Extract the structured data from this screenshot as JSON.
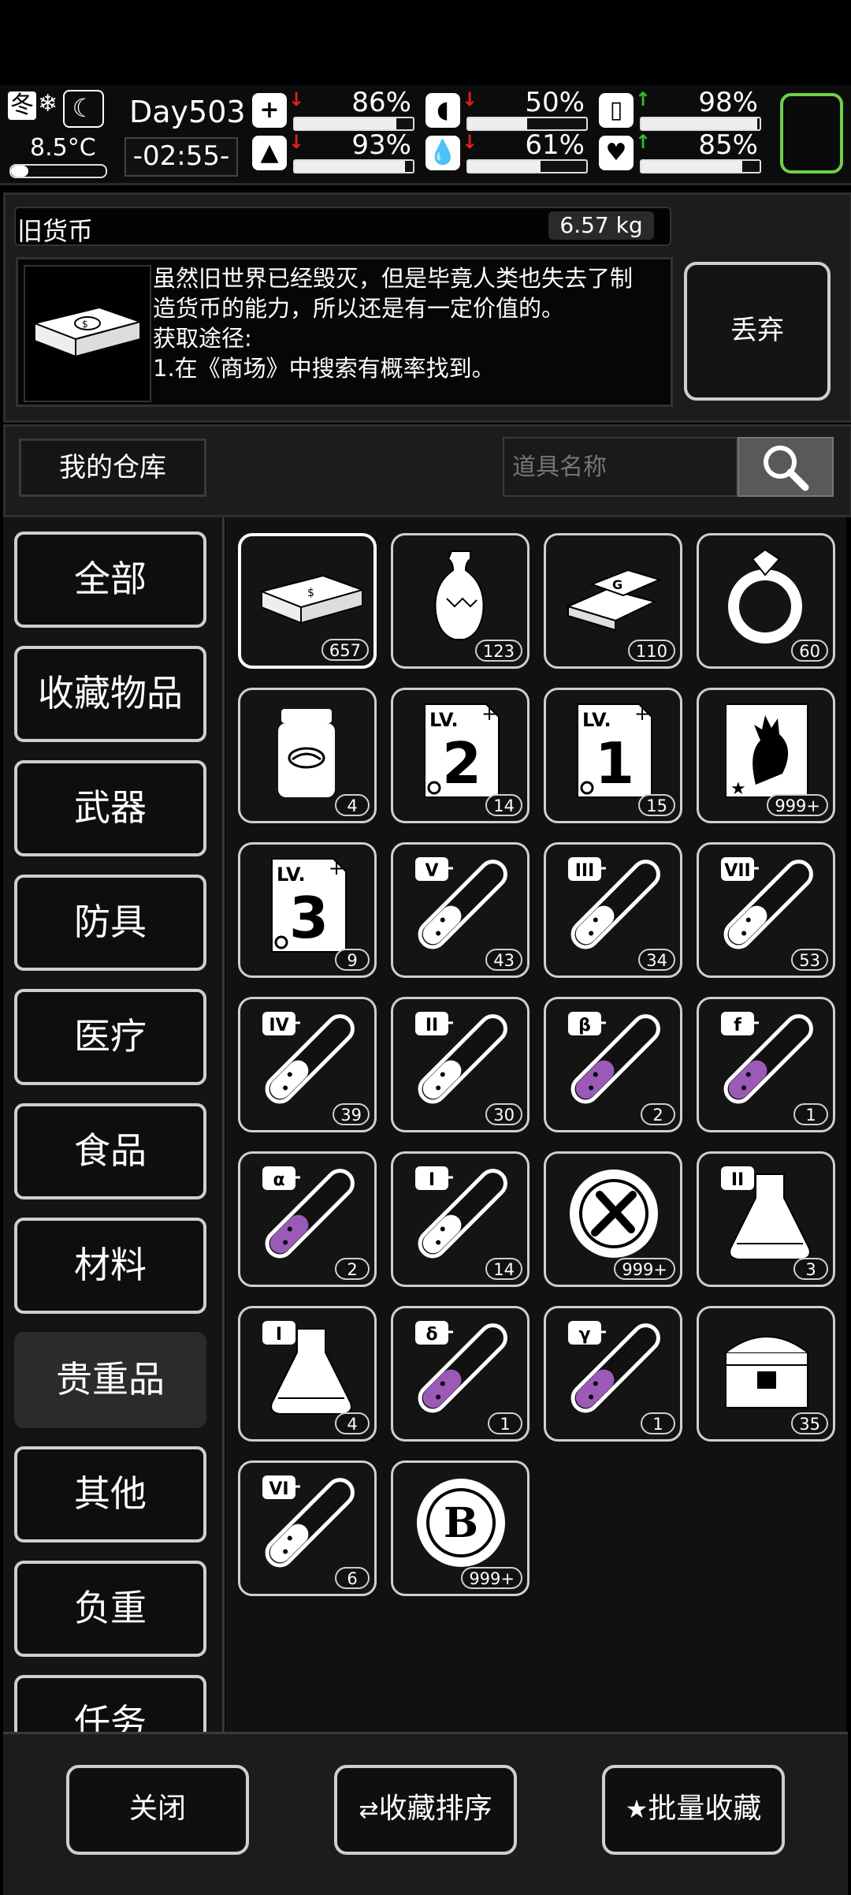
{
  "status": {
    "season": "冬",
    "temperature": "8.5°C",
    "day": "Day503",
    "time": "-02:55-",
    "stats": [
      {
        "name": "health",
        "icon": "+",
        "arrow": "down",
        "value": "86%",
        "level": 0.86
      },
      {
        "name": "stomach",
        "icon": "◖",
        "arrow": "down",
        "value": "50%",
        "level": 0.5
      },
      {
        "name": "pill",
        "icon": "▯",
        "arrow": "up",
        "value": "98%",
        "level": 0.98
      },
      {
        "name": "stamina",
        "icon": "▲",
        "arrow": "down",
        "value": "93%",
        "level": 0.93
      },
      {
        "name": "water",
        "icon": "💧",
        "arrow": "down",
        "value": "61%",
        "level": 0.61
      },
      {
        "name": "mood",
        "icon": "♥",
        "arrow": "up",
        "value": "85%",
        "level": 0.85
      }
    ],
    "accent_green": "#6fd04a",
    "arrow_down_color": "#e02020",
    "arrow_up_color": "#2cc02c"
  },
  "detail": {
    "item_name": "旧货币",
    "weight": "6.57 kg",
    "description": [
      "虽然旧世界已经毁灭，但是毕竟人类也失去了制",
      "造货币的能力，所以还是有一定价值的。",
      "获取途径:",
      "1.在《商场》中搜索有概率找到。"
    ],
    "discard_label": "丢弃"
  },
  "warehouse": {
    "title": "我的仓库",
    "search_placeholder": "道具名称"
  },
  "categories": [
    "全部",
    "收藏物品",
    "武器",
    "防具",
    "医疗",
    "食品",
    "材料",
    "贵重品",
    "其他",
    "负重",
    "任务"
  ],
  "active_category": "贵重品",
  "items": [
    {
      "icon": "money-stack-icon",
      "count": "657",
      "selected": true
    },
    {
      "icon": "vase-icon",
      "count": "123"
    },
    {
      "icon": "gold-bars-icon",
      "count": "110"
    },
    {
      "icon": "ring-icon",
      "count": "60"
    },
    {
      "icon": "jar-icon",
      "count": "4"
    },
    {
      "icon": "skill-book-lv2-icon",
      "label": "2",
      "count": "14"
    },
    {
      "icon": "skill-book-lv1-icon",
      "label": "1",
      "count": "15"
    },
    {
      "icon": "zombie-card-icon",
      "count": "999+"
    },
    {
      "icon": "skill-book-lv3-icon",
      "label": "3",
      "count": "9"
    },
    {
      "icon": "test-tube-icon",
      "label": "V",
      "count": "43",
      "liquid": "#ffffff"
    },
    {
      "icon": "test-tube-icon",
      "label": "III",
      "count": "34",
      "liquid": "#ffffff"
    },
    {
      "icon": "test-tube-icon",
      "label": "VII",
      "count": "53",
      "liquid": "#ffffff"
    },
    {
      "icon": "test-tube-icon",
      "label": "IV",
      "count": "39",
      "liquid": "#ffffff"
    },
    {
      "icon": "test-tube-icon",
      "label": "II",
      "count": "30",
      "liquid": "#ffffff"
    },
    {
      "icon": "test-tube-icon",
      "label": "β",
      "count": "2",
      "liquid": "#9b5ab8"
    },
    {
      "icon": "test-tube-icon",
      "label": "f",
      "count": "1",
      "liquid": "#9b5ab8"
    },
    {
      "icon": "test-tube-icon",
      "label": "α",
      "count": "2",
      "liquid": "#9b5ab8"
    },
    {
      "icon": "test-tube-icon",
      "label": "I",
      "count": "14",
      "liquid": "#ffffff"
    },
    {
      "icon": "tool-badge-icon",
      "count": "999+"
    },
    {
      "icon": "flask-icon",
      "label": "II",
      "count": "3",
      "liquid": "#ffffff"
    },
    {
      "icon": "flask-icon",
      "label": "I",
      "count": "4",
      "liquid": "#ffffff"
    },
    {
      "icon": "test-tube-icon",
      "label": "δ",
      "count": "1",
      "liquid": "#9b5ab8"
    },
    {
      "icon": "test-tube-icon",
      "label": "γ",
      "count": "1",
      "liquid": "#9b5ab8"
    },
    {
      "icon": "chest-icon",
      "count": "35"
    },
    {
      "icon": "test-tube-icon",
      "label": "VI",
      "count": "6",
      "liquid": "#ffffff"
    },
    {
      "icon": "b-coin-icon",
      "label": "B",
      "count": "999+"
    }
  ],
  "bottom": {
    "close_label": "关闭",
    "sort_label": "收藏排序",
    "batch_label": "批量收藏"
  }
}
